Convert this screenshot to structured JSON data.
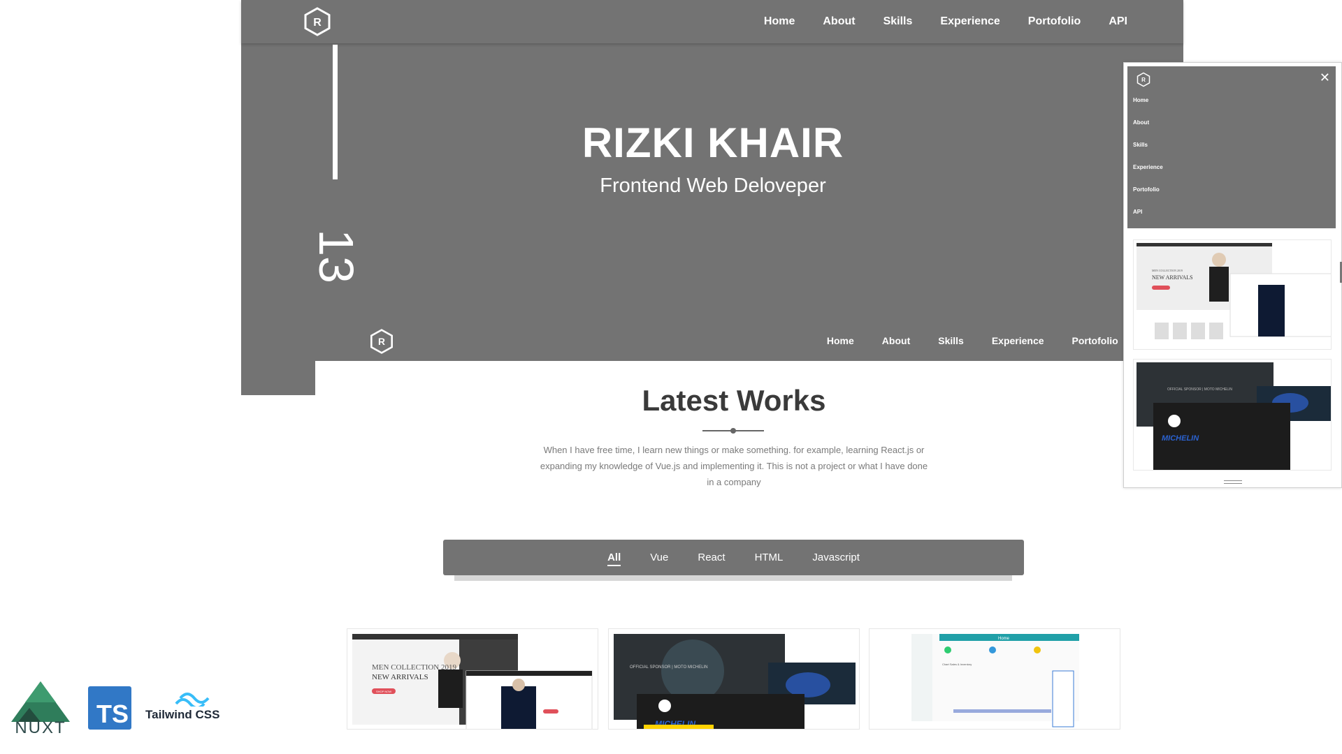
{
  "brand": {
    "logo_letter": "R"
  },
  "nav": {
    "items": [
      "Home",
      "About",
      "Skills",
      "Experience",
      "Portofolio",
      "API"
    ]
  },
  "hero": {
    "number": "13",
    "title": "RIZKI KHAIR",
    "subtitle": "Frontend Web Deloveper"
  },
  "works": {
    "title": "Latest Works",
    "description": "When I have free time, I learn new things or make something. for example, learning React.js or expanding my knowledge of Vue.js and implementing it. This is not a project or what I have done in a company",
    "filters": [
      "All",
      "Vue",
      "React",
      "HTML",
      "Javascript"
    ],
    "active_filter": "All"
  },
  "cards": {
    "shop": {
      "collection": "MEN COLLECTION 2019",
      "headline": "NEW ARRIVALS",
      "button": "SHOP NOW"
    },
    "moto": {
      "tagline": "OFFICIAL SPONSOR | MOTO MICHELIN",
      "brand": "MICHELIN"
    },
    "dash": {
      "header": "Home",
      "panel": "Chart Sales & Inventory"
    }
  },
  "mobile_menu": {
    "close_glyph": "✕"
  },
  "tech_logos": {
    "nuxt": "NUXT",
    "ts": "TS",
    "tailwind": "Tailwind CSS"
  },
  "colors": {
    "primary_gray": "#737373",
    "title": "#3a3a3a",
    "ts_blue": "#3178c6",
    "nuxt_green": "#00dc82",
    "tailwind_teal": "#38bdf8"
  }
}
